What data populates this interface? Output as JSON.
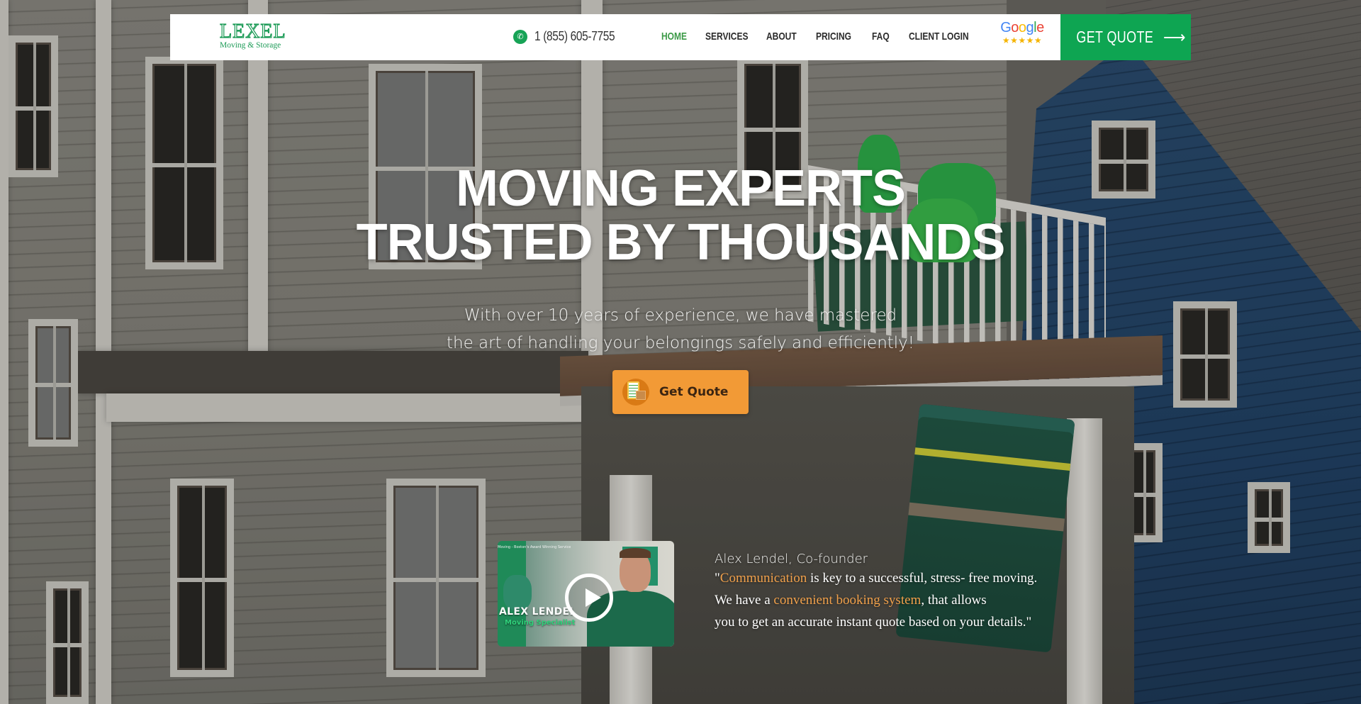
{
  "brand": {
    "logo_word": "LEXEL",
    "logo_sub": "Moving & Storage",
    "color_primary": "#0ea552",
    "color_accent": "#f29a36"
  },
  "header": {
    "phone_icon": "phone-icon",
    "phone": "1 (855) 605-7755",
    "nav": [
      {
        "label": "HOME",
        "active": true
      },
      {
        "label": "SERVICES",
        "active": false
      },
      {
        "label": "ABOUT",
        "active": false
      },
      {
        "label": "PRICING",
        "active": false
      },
      {
        "label": "FAQ",
        "active": false
      },
      {
        "label": "CLIENT LOGIN",
        "active": false
      }
    ],
    "google_badge": {
      "word_letters": [
        "G",
        "o",
        "o",
        "g",
        "l",
        "e"
      ],
      "stars": "★★★★★",
      "rating": 5
    },
    "cta_label": "GET QUOTE",
    "cta_icon": "arrow-right-icon"
  },
  "hero": {
    "title_line1": "MOVING EXPERTS",
    "title_line2": "TRUSTED BY THOUSANDS",
    "subtitle_line1": "With over 10 years of experience, we have mastered",
    "subtitle_line2": "the art of handling your belongings safely and efficiently!",
    "cta_label": "Get Quote",
    "cta_icon": "clipboard-boxes-icon"
  },
  "video": {
    "caption_top": "Moving - Boston's Award Winning Service",
    "name_tag": "ALEX LENDEL",
    "role_tag": "Moving Specialist",
    "play_icon": "play-icon"
  },
  "testimonial": {
    "author": "Alex Lendel, Co-founder",
    "line1_pre": "\"",
    "line1_hl": "Communication",
    "line1_post": " is key to a successful, stress- free moving.",
    "line2_pre": "We have a ",
    "line2_hl": "convenient booking system",
    "line2_post": ", that allows",
    "line3": "you to get an accurate instant quote based on your details.\""
  }
}
